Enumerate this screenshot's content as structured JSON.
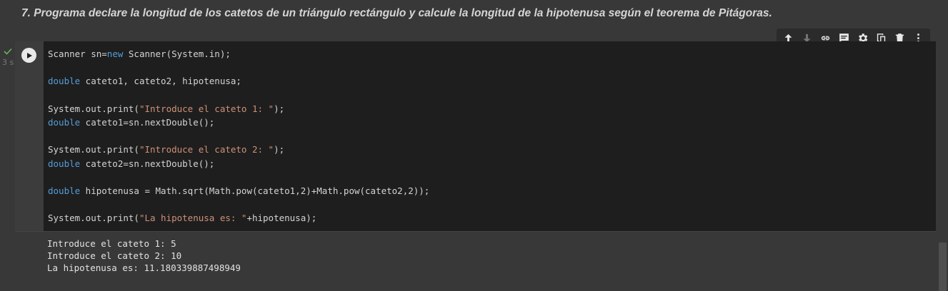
{
  "notebook": {
    "markdown_title": "7. Programa declare la longitud de los catetos de un triángulo rectángulo y calcule la longitud de la hipotenusa según el teorema de Pitágoras."
  },
  "cell": {
    "exec_time": "3 s",
    "status": "success",
    "code_lines": [
      [
        {
          "t": "Scanner sn=",
          "c": "plain"
        },
        {
          "t": "new",
          "c": "kw"
        },
        {
          "t": " Scanner(System.in);",
          "c": "plain"
        }
      ],
      [],
      [
        {
          "t": "double",
          "c": "kw"
        },
        {
          "t": " cateto1, cateto2, hipotenusa;",
          "c": "plain"
        }
      ],
      [],
      [
        {
          "t": "System.out.print(",
          "c": "plain"
        },
        {
          "t": "\"Introduce el cateto 1: \"",
          "c": "str"
        },
        {
          "t": ");",
          "c": "plain"
        }
      ],
      [
        {
          "t": "double",
          "c": "kw"
        },
        {
          "t": " cateto1=sn.nextDouble();",
          "c": "plain"
        }
      ],
      [],
      [
        {
          "t": "System.out.print(",
          "c": "plain"
        },
        {
          "t": "\"Introduce el cateto 2: \"",
          "c": "str"
        },
        {
          "t": ");",
          "c": "plain"
        }
      ],
      [
        {
          "t": "double",
          "c": "kw"
        },
        {
          "t": " cateto2=sn.nextDouble();",
          "c": "plain"
        }
      ],
      [],
      [
        {
          "t": "double",
          "c": "kw"
        },
        {
          "t": " hipotenusa = Math.sqrt(Math.pow(cateto1,2)+Math.pow(cateto2,2));",
          "c": "plain"
        }
      ],
      [],
      [
        {
          "t": "System.out.print(",
          "c": "plain"
        },
        {
          "t": "\"La hipotenusa es: \"",
          "c": "str"
        },
        {
          "t": "+hipotenusa);",
          "c": "plain"
        }
      ]
    ],
    "output_lines": [
      "Introduce el cateto 1: 5",
      "Introduce el cateto 2: 10",
      "La hipotenusa es: 11.180339887498949"
    ]
  },
  "toolbar": {
    "icons": [
      "arrow-up-icon",
      "arrow-down-icon",
      "link-icon",
      "comment-icon",
      "gear-icon",
      "mirror-cell-icon",
      "delete-icon",
      "more-vert-icon"
    ]
  },
  "colors": {
    "keyword": "#569cd6",
    "string": "#ce9178",
    "code_text": "#d4d4d4",
    "success_check": "#5fb85f"
  }
}
